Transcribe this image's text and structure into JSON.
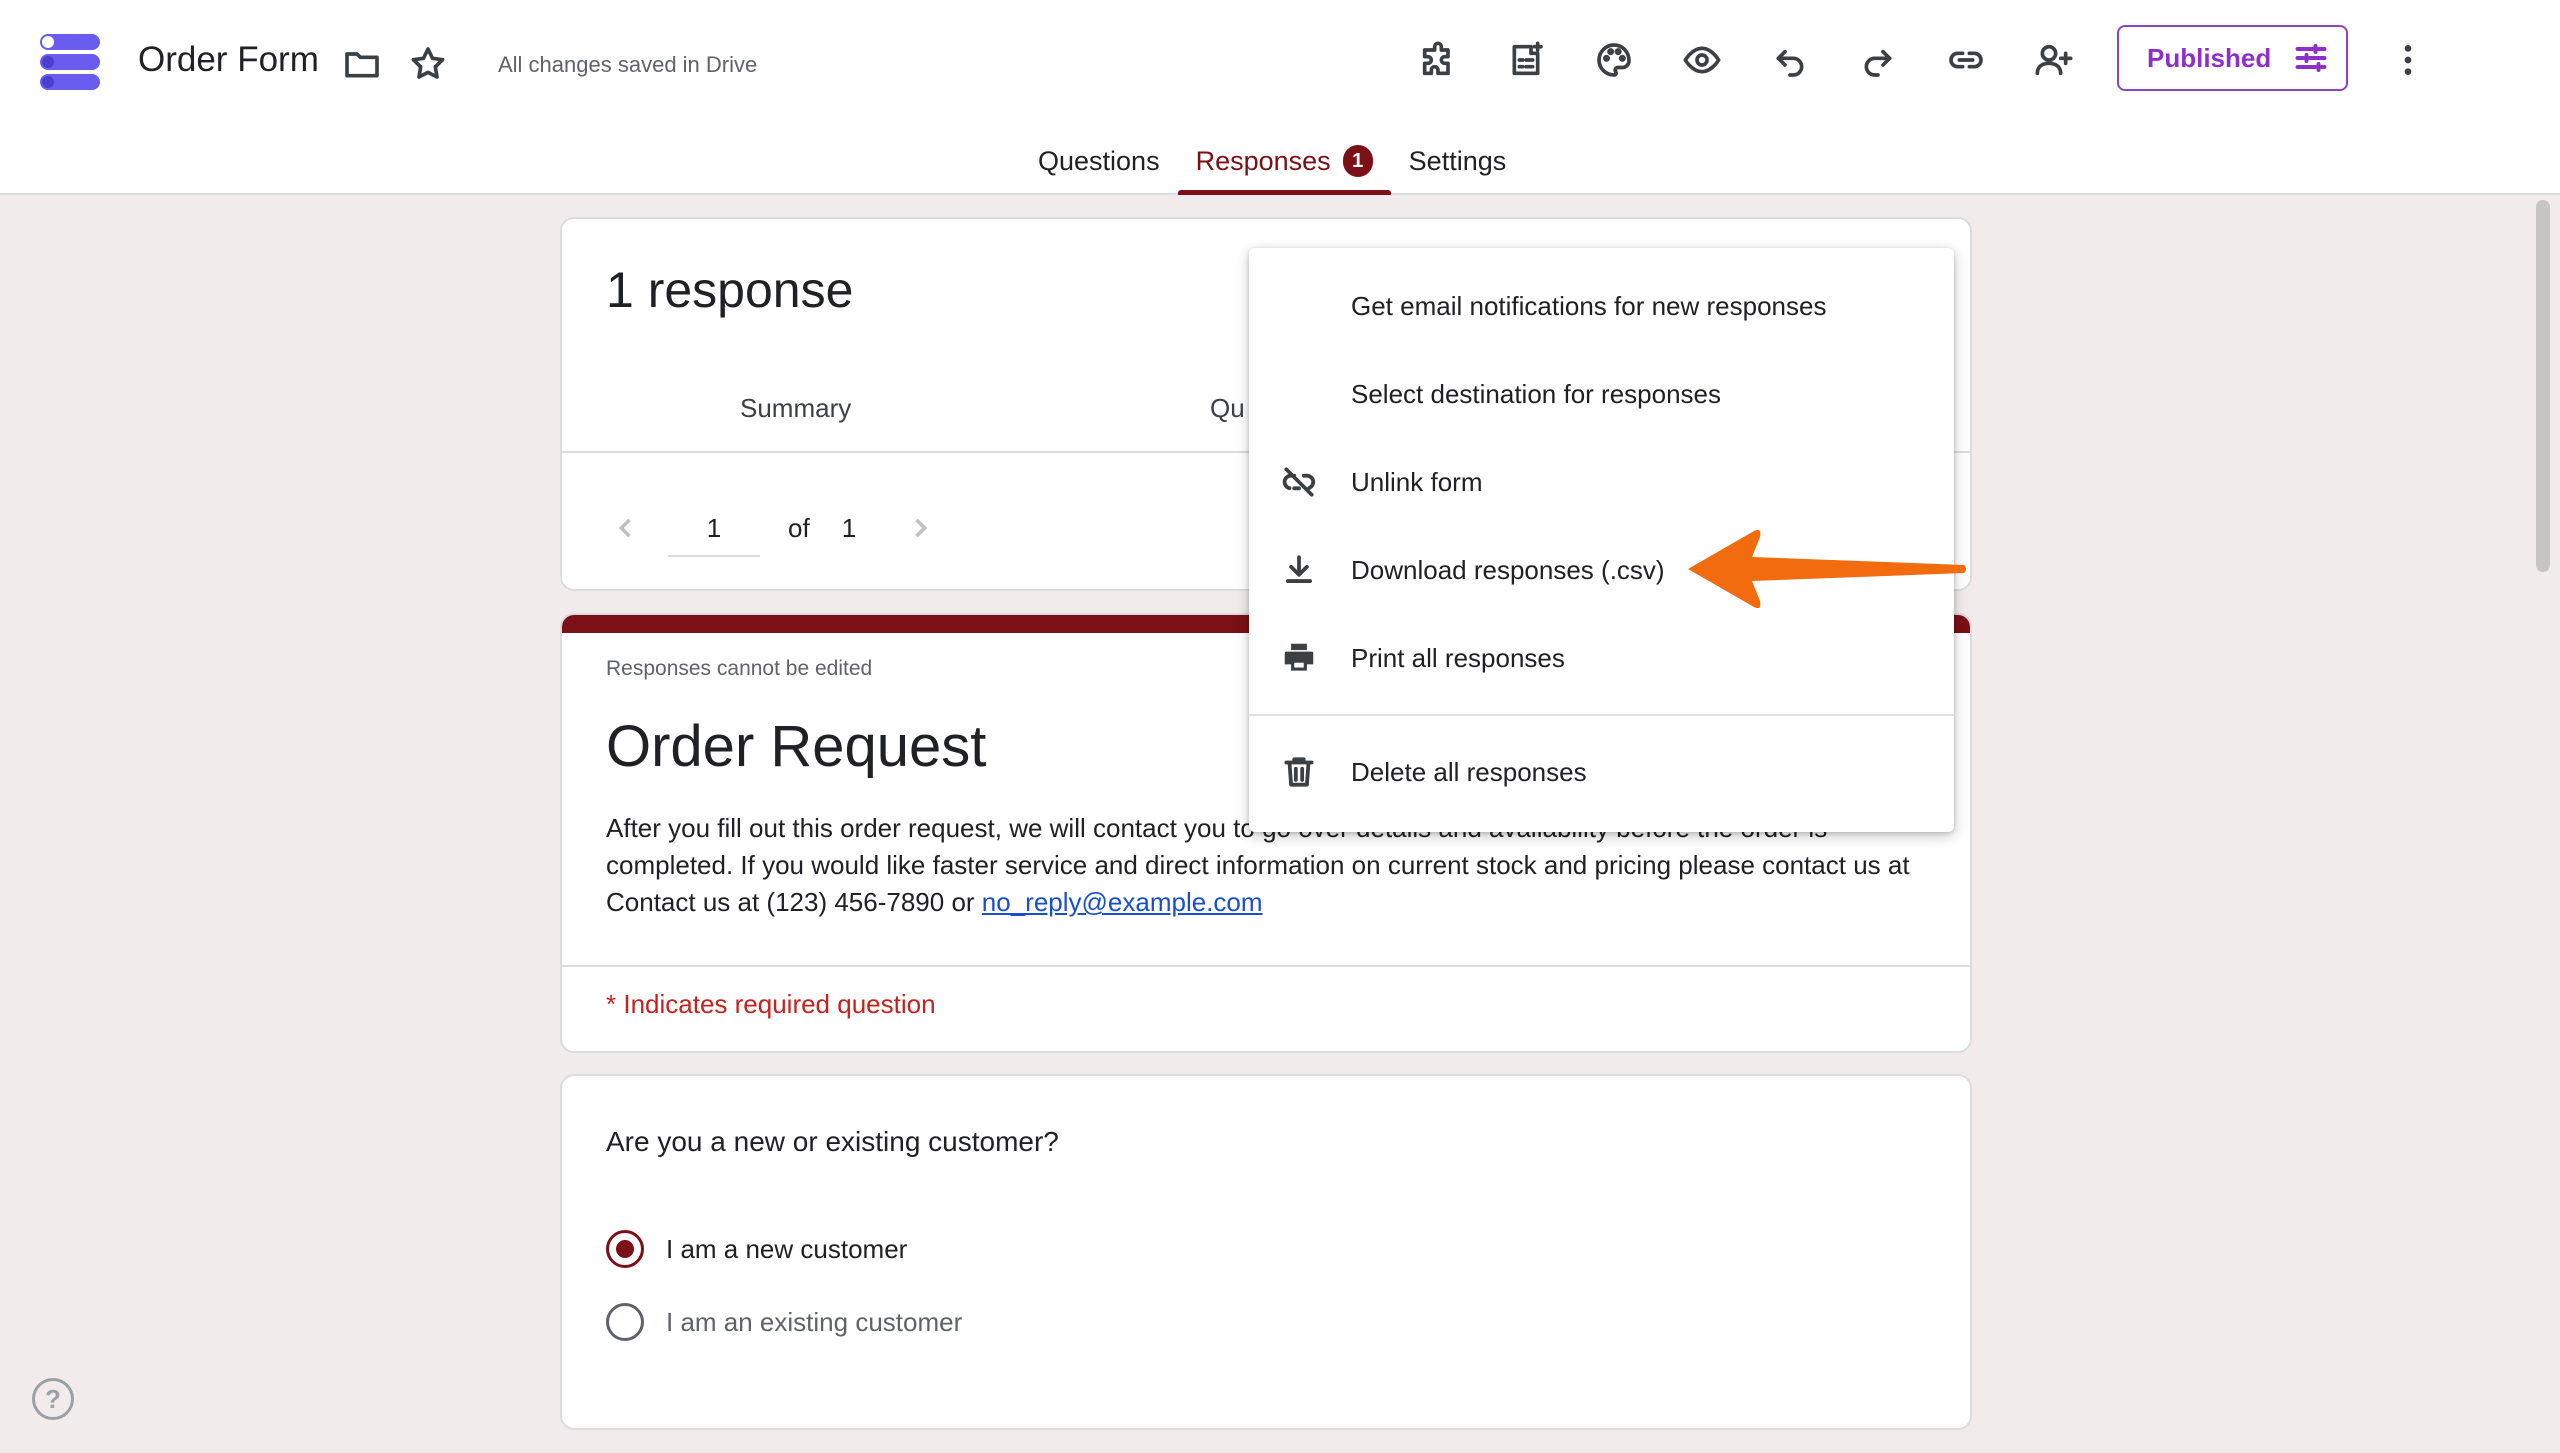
{
  "header": {
    "title": "Order Form",
    "save_status": "All changes saved in Drive",
    "publish_label": "Published",
    "tabs": [
      {
        "label": "Questions"
      },
      {
        "label": "Responses",
        "badge": "1"
      },
      {
        "label": "Settings"
      }
    ]
  },
  "responses": {
    "count_label": "1 response",
    "subtabs": [
      "Summary",
      "Qu"
    ],
    "pager": {
      "current": "1",
      "of_label": "of",
      "total": "1"
    }
  },
  "menu": {
    "items": [
      {
        "label": "Get email notifications for new responses",
        "icon": ""
      },
      {
        "label": "Select destination for responses",
        "icon": ""
      },
      {
        "label": "Unlink form",
        "icon": "unlink-icon"
      },
      {
        "label": "Download responses (.csv)",
        "icon": "download-icon"
      },
      {
        "label": "Print all responses",
        "icon": "print-icon"
      },
      {
        "label": "Delete all responses",
        "icon": "trash-icon"
      }
    ]
  },
  "form": {
    "notice": "Responses cannot be edited",
    "heading": "Order Request",
    "description_prefix": "After you fill out this order request, we will contact you to go over details and availability before the order is completed. If you would like faster service and direct information on current stock and pricing please contact us at Contact us at (123) 456-7890 or ",
    "email": "no_reply@example.com",
    "required_note": "* Indicates required question"
  },
  "question": {
    "title": "Are you a new or existing customer?",
    "options": [
      {
        "label": "I am a new customer",
        "checked": true
      },
      {
        "label": "I am an existing customer",
        "checked": false
      }
    ]
  },
  "help_label": "?",
  "colors": {
    "accent": "#7b1016",
    "publish": "#8e2fc9",
    "arrow": "#f36b0f"
  }
}
